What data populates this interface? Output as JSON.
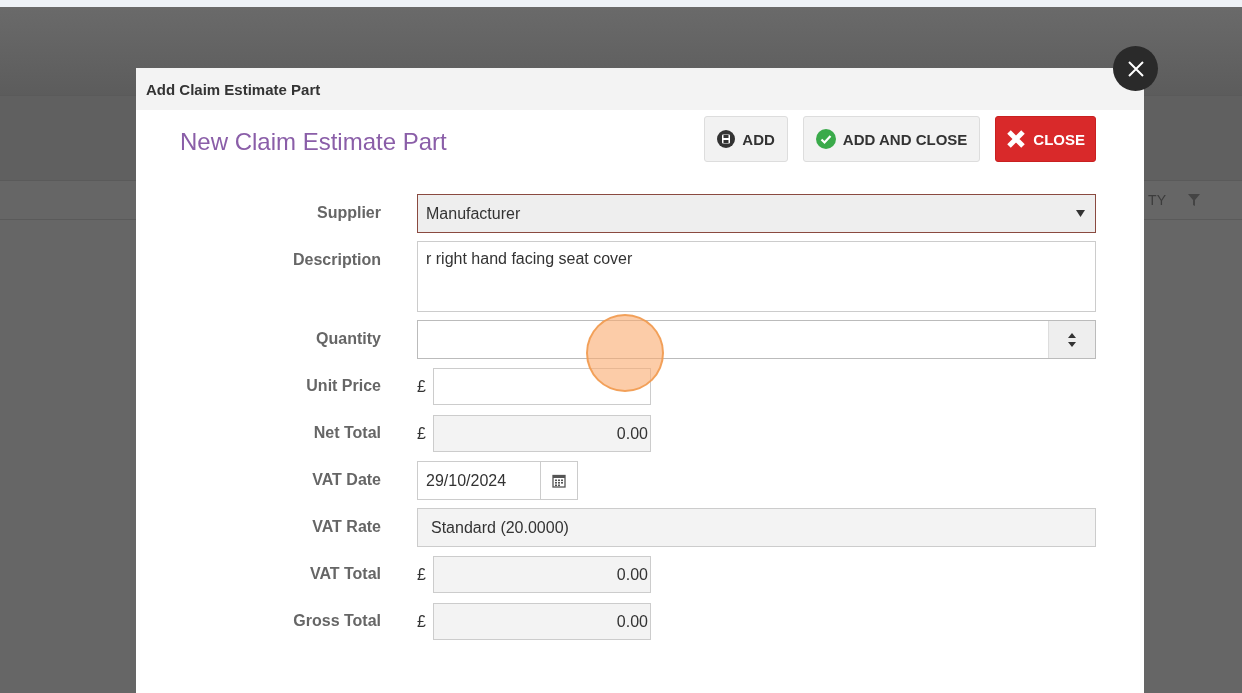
{
  "background": {
    "column_header": "TY"
  },
  "dialog": {
    "title": "Add Claim Estimate Part",
    "heading": "New Claim Estimate Part",
    "buttons": [
      {
        "kind": "save",
        "label": "ADD"
      },
      {
        "kind": "confirm",
        "label": "ADD AND CLOSE"
      },
      {
        "kind": "cancel",
        "label": "CLOSE"
      }
    ],
    "fields": [
      {
        "kind": "select",
        "label": "Supplier",
        "value": "Manufacturer"
      },
      {
        "kind": "textarea",
        "label": "Description",
        "value": "r right hand facing seat cover"
      },
      {
        "kind": "number",
        "label": "Quantity"
      },
      {
        "kind": "currency",
        "label": "Unit Price",
        "prefix": "£",
        "disabled": false
      },
      {
        "kind": "currency",
        "label": "Net Total",
        "prefix": "£",
        "value": "0.00",
        "disabled": true
      },
      {
        "kind": "date",
        "label": "VAT Date",
        "value": "29/10/2024"
      },
      {
        "kind": "readonly",
        "label": "VAT Rate",
        "value": "Standard (20.0000)"
      },
      {
        "kind": "currency",
        "label": "VAT Total",
        "prefix": "£",
        "value": "0.00",
        "disabled": true
      },
      {
        "kind": "currency",
        "label": "Gross Total",
        "prefix": "£",
        "value": "0.00",
        "disabled": true
      }
    ]
  },
  "click_highlight": true
}
